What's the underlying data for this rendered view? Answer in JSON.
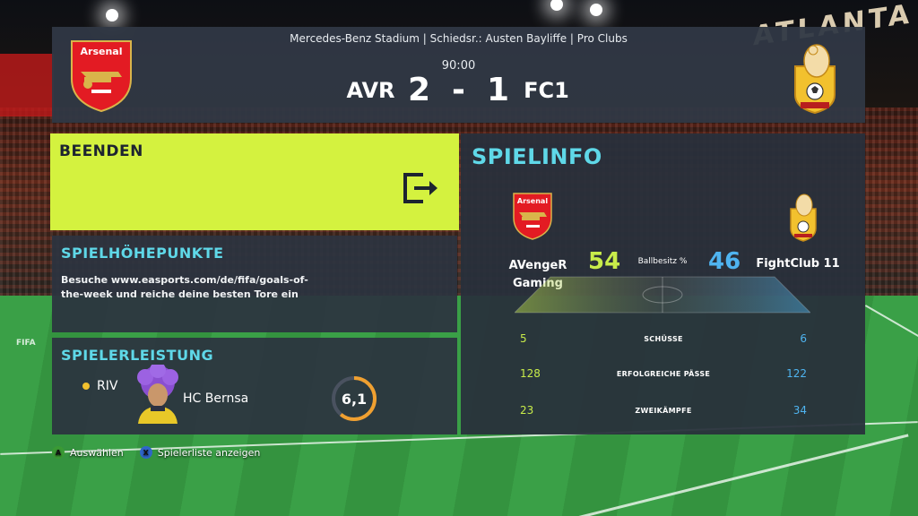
{
  "header": {
    "venue_line": "Mercedes-Benz Stadium | Schiedsr.: Austen Bayliffe | Pro Clubs",
    "clock": "90:00",
    "home_abbr": "AVR",
    "away_abbr": "FC1",
    "home_goals": "2",
    "separator": "-",
    "away_goals": "1",
    "home_crest_text": "Arsenal"
  },
  "quit": {
    "label": "BEENDEN",
    "icon": "exit-icon"
  },
  "highlights": {
    "title": "SPIELHÖHEPUNKTE",
    "text": "Besuche www.easports.com/de/fifa/goals-of-the-week und reiche deine besten Tore ein"
  },
  "performance": {
    "title": "SPIELERLEISTUNG",
    "position": "RIV",
    "club": "HC Bernsa",
    "rating": "6,1",
    "rating_fraction": 0.61
  },
  "matchinfo": {
    "title": "SPIELINFO",
    "home_team_line1": "AVengeR",
    "home_team_line2": "Gaming",
    "away_team": "FightClub 11",
    "possession_label": "Ballbesitz %",
    "home_possession": "54",
    "away_possession": "46",
    "stats": [
      {
        "label": "SCHÜSSE",
        "home": "5",
        "away": "6"
      },
      {
        "label": "ERFOLGREICHE PÄSSE",
        "home": "128",
        "away": "122"
      },
      {
        "label": "ZWEIKÄMPFE",
        "home": "23",
        "away": "34"
      }
    ]
  },
  "footer": {
    "a_glyph": "A",
    "a_label": "Auswählen",
    "x_glyph": "X",
    "x_label": "Spielerliste anzeigen"
  },
  "colors": {
    "accent_lime": "#d4f23f",
    "accent_cyan": "#5fd8e8",
    "home_stat": "#c8ec4a",
    "away_stat": "#4fb4f0",
    "rating_ring": "#f0a030"
  },
  "background": {
    "sign_text": "ATLANTA",
    "ad_text": "FIFA"
  }
}
